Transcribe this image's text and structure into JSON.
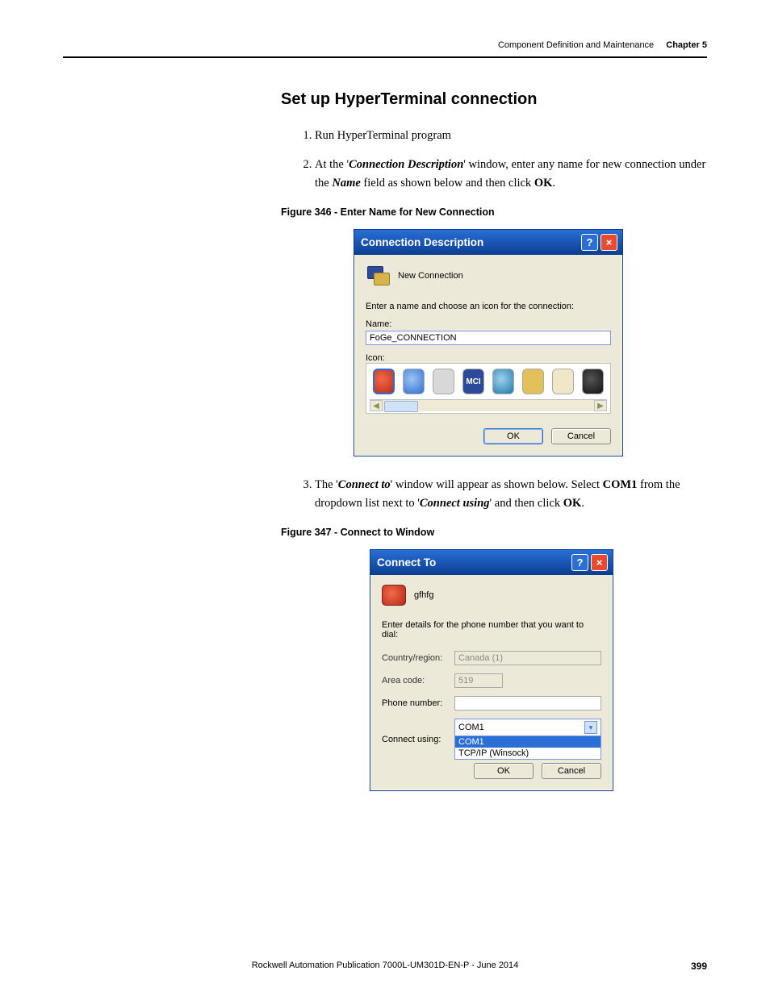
{
  "header": {
    "section": "Component Definition and Maintenance",
    "chapter": "Chapter 5"
  },
  "content": {
    "title": "Set up HyperTerminal connection",
    "step1": "Run HyperTerminal program",
    "step2_a": "At the '",
    "step2_b": "Connection Description",
    "step2_c": "' window, enter any name for new connection under the ",
    "step2_d": "Name",
    "step2_e": " field as shown below and then click ",
    "step2_f": "OK",
    "step2_g": ".",
    "fig346": "Figure 346 - Enter Name for New Connection",
    "step3_a": "The '",
    "step3_b": "Connect to",
    "step3_c": "' window will appear as shown below. Select ",
    "step3_d": "COM1",
    "step3_e": " from the dropdown list next to '",
    "step3_f": "Connect using",
    "step3_g": "' and then click ",
    "step3_h": "OK",
    "step3_i": ".",
    "fig347": "Figure 347 - Connect to Window"
  },
  "dialog1": {
    "title": "Connection Description",
    "subtitle": "New Connection",
    "instruction": "Enter a name and choose an icon for the connection:",
    "name_label": "Name:",
    "name_value": "FoGe_CONNECTION",
    "icon_label": "Icon:",
    "mci": "MCI",
    "btn_ok": "OK",
    "btn_cancel": "Cancel"
  },
  "dialog2": {
    "title": "Connect To",
    "conn_name": "gfhfg",
    "instruction": "Enter details for the phone number that you want to dial:",
    "country_label": "Country/region:",
    "country_value": "Canada (1)",
    "area_label": "Area code:",
    "area_value": "519",
    "phone_label": "Phone number:",
    "phone_value": "",
    "connect_label": "Connect using:",
    "connect_value": "COM1",
    "opt1": "COM1",
    "opt2": "TCP/IP (Winsock)",
    "btn_ok": "OK",
    "btn_cancel": "Cancel"
  },
  "footer": {
    "publication": "Rockwell Automation Publication 7000L-UM301D-EN-P - June 2014",
    "page": "399"
  }
}
